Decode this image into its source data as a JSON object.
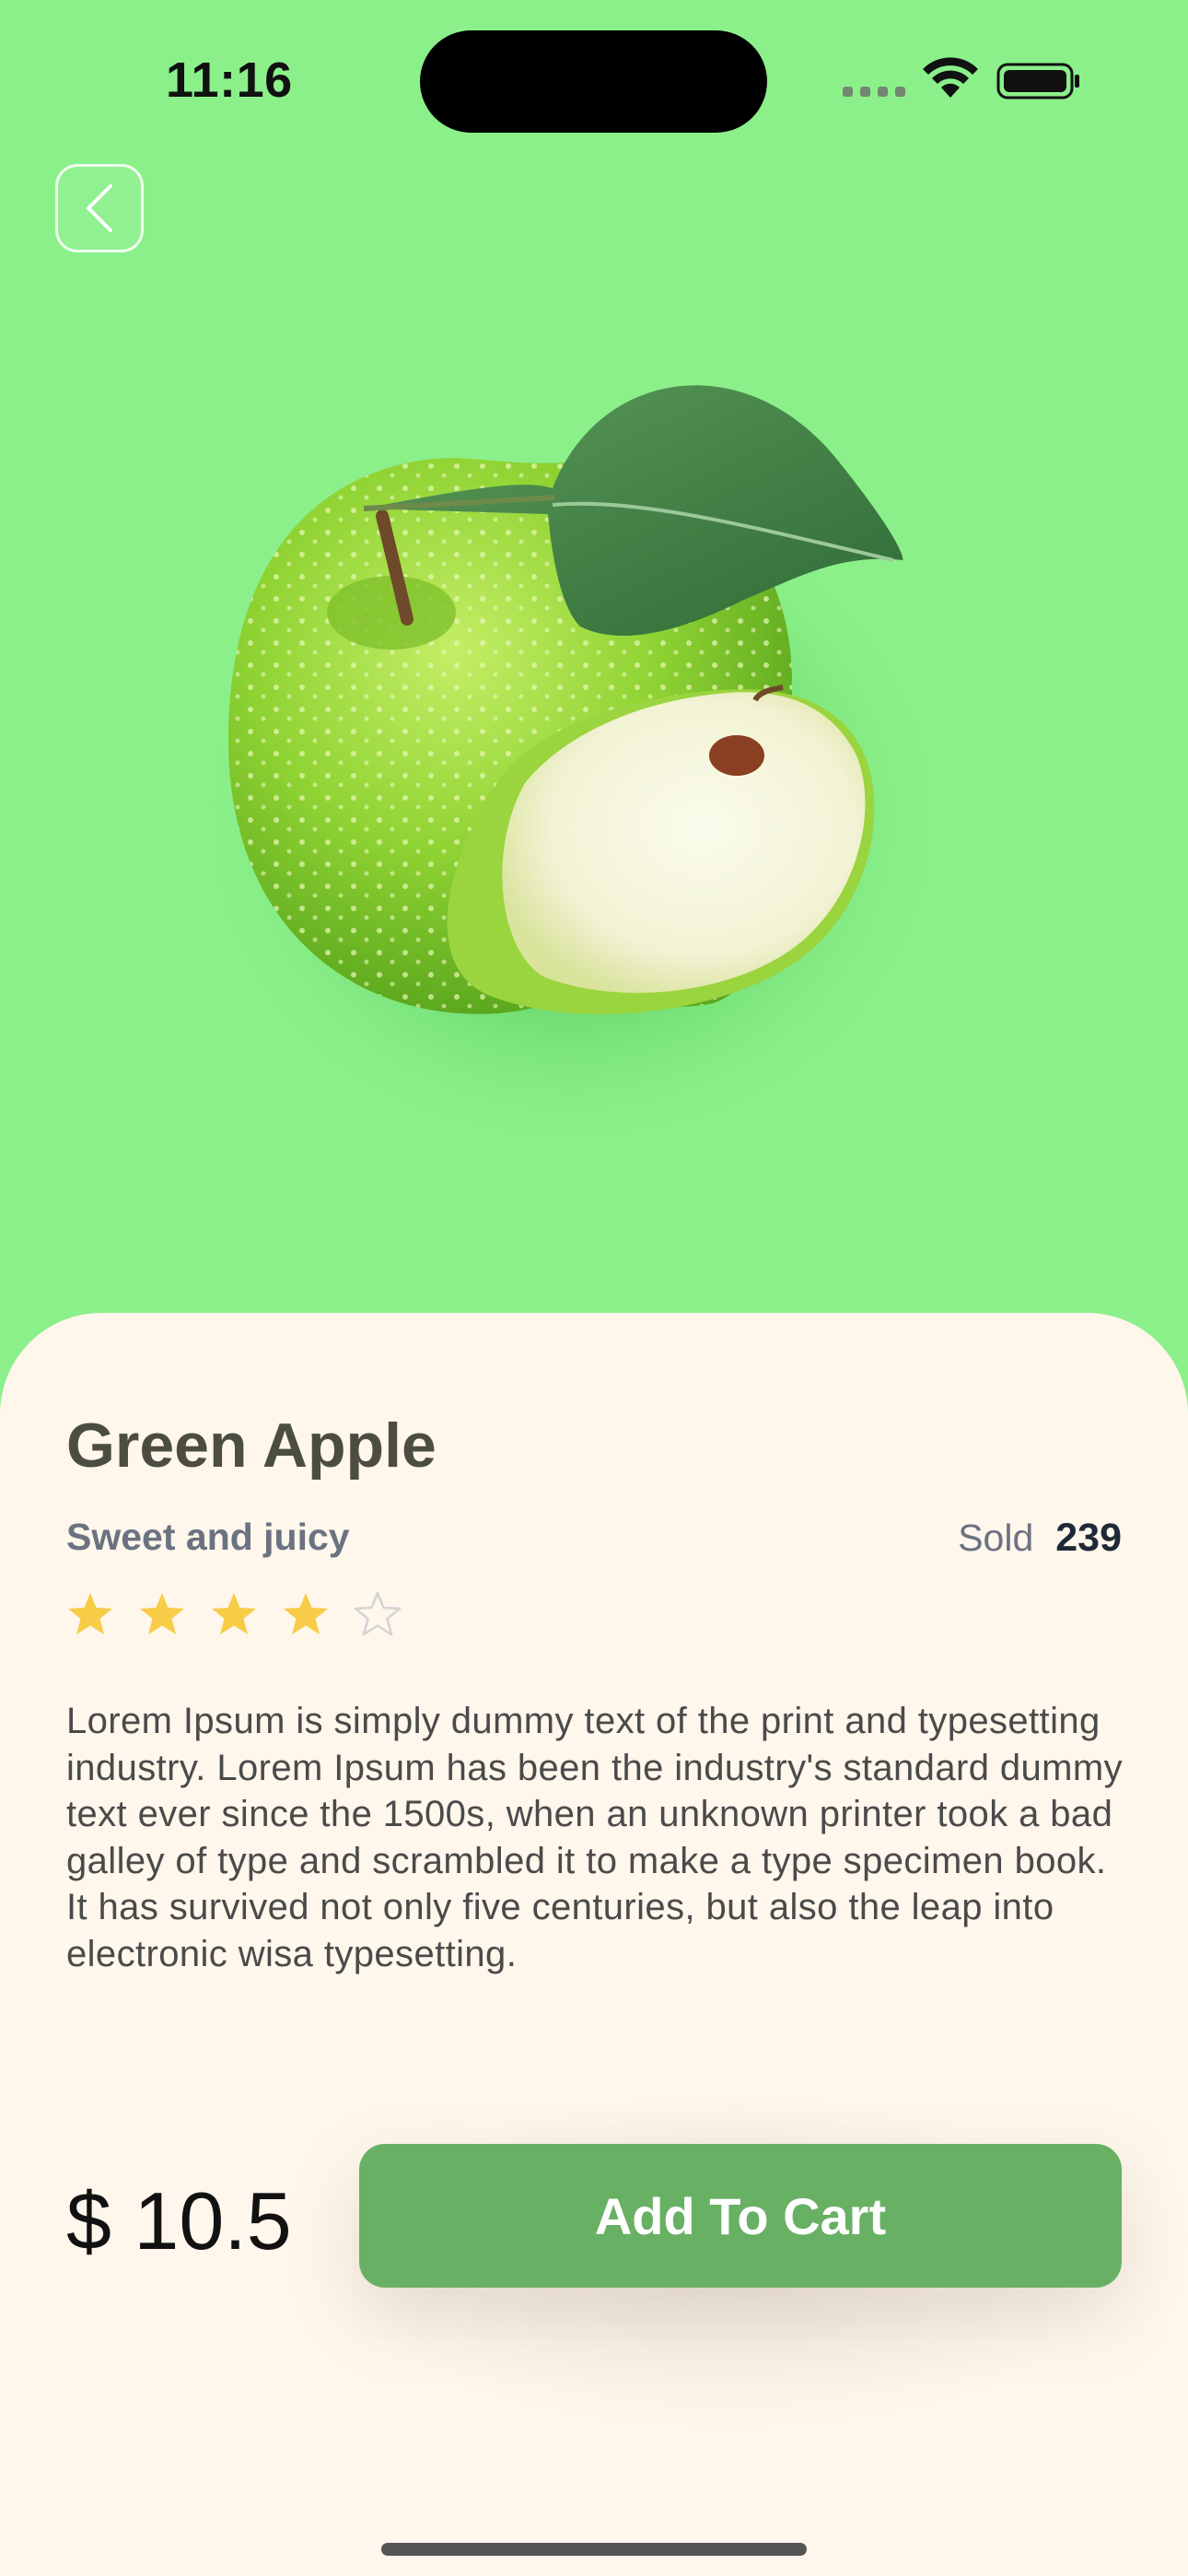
{
  "status_bar": {
    "time": "11:16"
  },
  "navigation": {
    "back_icon": "chevron-left-icon"
  },
  "product": {
    "image_icon": "green-apple-image",
    "name": "Green Apple",
    "subtitle": "Sweet and juicy",
    "sold_label": "Sold",
    "sold_count": "239",
    "rating": 4,
    "rating_max": 5,
    "description": "Lorem Ipsum is simply dummy text of the print and typesetting industry. Lorem Ipsum has been the industry's standard dummy text ever since the 1500s, when an unknown printer took a bad galley of type and scrambled it to make a type specimen book. It has survived not only five centuries, but also the leap into electronic wisa typesetting.",
    "price": "$ 10.5"
  },
  "actions": {
    "add_to_cart_label": "Add To Cart"
  },
  "colors": {
    "hero_background": "#8BF08A",
    "sheet_background": "#FFF6EC",
    "button_green": "#68B063",
    "star_yellow": "#F7CC47"
  }
}
